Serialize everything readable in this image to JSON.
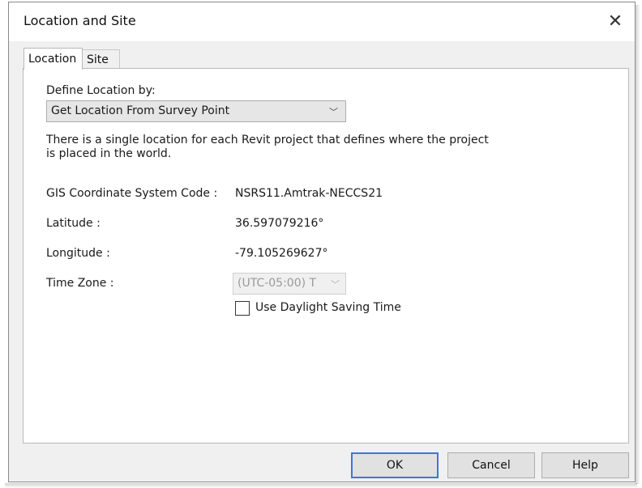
{
  "window": {
    "title": "Location and Site",
    "close_glyph": "✕"
  },
  "tabs": [
    {
      "label": "Location",
      "active": true
    },
    {
      "label": "Site",
      "active": false
    }
  ],
  "location": {
    "define_label": "Define Location by:",
    "define_value": "Get Location From Survey Point",
    "description": "There is a single location for each Revit project that defines where the project is placed in the world.",
    "gis_label": "GIS Coordinate System Code :",
    "gis_value": "NSRS11.Amtrak-NECCS21",
    "latitude_label": "Latitude :",
    "latitude_value": "36.597079216°",
    "longitude_label": "Longitude :",
    "longitude_value": "-79.105269627°",
    "timezone_label": "Time Zone :",
    "timezone_value": "(UTC-05:00) T",
    "timezone_disabled": true,
    "dst_label": "Use Daylight Saving Time",
    "dst_checked": false
  },
  "buttons": {
    "ok": "OK",
    "cancel": "Cancel",
    "help": "Help"
  },
  "colors": {
    "default_button_border": "#3b78d8",
    "dialog_bg": "#f0f0f0",
    "panel_bg": "#ffffff"
  },
  "icons": {
    "dropdown": "chevron-down-icon",
    "close": "close-icon"
  }
}
